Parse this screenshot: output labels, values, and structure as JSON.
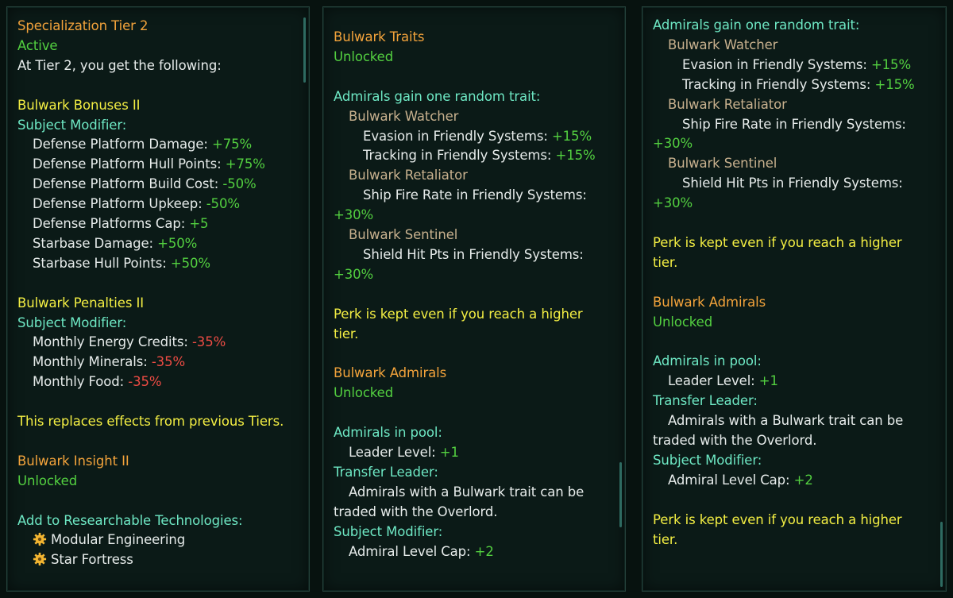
{
  "panel1": {
    "title": "Specialization Tier 2",
    "status": "Active",
    "intro": "At Tier 2, you get the following:",
    "bonuses_title": "Bulwark Bonuses II",
    "bonuses_subject": "Subject Modifier:",
    "bonuses": [
      {
        "label": "Defense Platform Damage: ",
        "value": "+75%"
      },
      {
        "label": "Defense Platform Hull Points: ",
        "value": "+75%"
      },
      {
        "label": "Defense Platform Build Cost: ",
        "value": "-50%"
      },
      {
        "label": "Defense Platform Upkeep: ",
        "value": "-50%"
      },
      {
        "label": "Defense Platforms Cap: ",
        "value": "+5"
      },
      {
        "label": "Starbase Damage: ",
        "value": "+50%"
      },
      {
        "label": "Starbase Hull Points: ",
        "value": "+50%"
      }
    ],
    "penalties_title": "Bulwark Penalties II",
    "penalties_subject": "Subject Modifier:",
    "penalties": [
      {
        "label": "Monthly Energy Credits: ",
        "value": "-35%"
      },
      {
        "label": "Monthly Minerals: ",
        "value": "-35%"
      },
      {
        "label": "Monthly Food: ",
        "value": "-35%"
      }
    ],
    "replace_note": "This replaces effects from previous Tiers.",
    "insight_title": "Bulwark Insight II",
    "insight_status": "Unlocked",
    "research_heading": "Add to Researchable Technologies:",
    "techs": [
      "Modular Engineering",
      "Star Fortress"
    ]
  },
  "panel2": {
    "traits_title": "Bulwark Traits",
    "traits_status": "Unlocked",
    "trait_intro": "Admirals gain one random trait:",
    "watcher_name": "Bulwark Watcher",
    "watcher_effects": [
      {
        "label": "Evasion in Friendly Systems: ",
        "value": "+15%"
      },
      {
        "label": "Tracking in Friendly Systems: ",
        "value": "+15%"
      }
    ],
    "retaliator_name": "Bulwark Retaliator",
    "retaliator_effect_label": "Ship Fire Rate in Friendly Systems:",
    "retaliator_effect_value": "+30%",
    "sentinel_name": "Bulwark Sentinel",
    "sentinel_effect_label": "Shield Hit Pts in Friendly Systems:",
    "sentinel_effect_value": "+30%",
    "perk_note_1": "Perk is kept even if you reach a higher",
    "perk_note_2": "tier.",
    "admirals_title": "Bulwark Admirals",
    "admirals_status": "Unlocked",
    "pool_heading": "Admirals in pool:",
    "leader_level_label": "Leader Level: ",
    "leader_level_value": "+1",
    "transfer_heading": "Transfer Leader:",
    "transfer_text_1": "Admirals with a Bulwark trait can be",
    "transfer_text_2": "traded with the Overlord.",
    "subject_heading": "Subject Modifier:",
    "admiral_cap_label": "Admiral Level Cap: ",
    "admiral_cap_value": "+2"
  },
  "panel3": {
    "trait_intro": "Admirals gain one random trait:",
    "watcher_name": "Bulwark Watcher",
    "watcher_effects": [
      {
        "label": "Evasion in Friendly Systems: ",
        "value": "+15%"
      },
      {
        "label": "Tracking in Friendly Systems: ",
        "value": "+15%"
      }
    ],
    "retaliator_name": "Bulwark Retaliator",
    "retaliator_effect_label": "Ship Fire Rate in Friendly Systems:",
    "retaliator_effect_value": "+30%",
    "sentinel_name": "Bulwark Sentinel",
    "sentinel_effect_label": "Shield Hit Pts in Friendly Systems:",
    "sentinel_effect_value": "+30%",
    "perk_note_1": "Perk is kept even if you reach a higher",
    "perk_note_2": "tier.",
    "admirals_title": "Bulwark Admirals",
    "admirals_status": "Unlocked",
    "pool_heading": "Admirals in pool:",
    "leader_level_label": "Leader Level: ",
    "leader_level_value": "+1",
    "transfer_heading": "Transfer Leader:",
    "transfer_text_1": "Admirals with a Bulwark trait can be",
    "transfer_text_2": "traded with the Overlord.",
    "subject_heading": "Subject Modifier:",
    "admiral_cap_label": "Admiral Level Cap: ",
    "admiral_cap_value": "+2",
    "perk_note_end_1": "Perk is kept even if you reach a higher",
    "perk_note_end_2": "tier."
  },
  "colors": {
    "title_orange": "#f3a33b",
    "status_green": "#53d040",
    "note_yellow": "#f3ee43",
    "subject_cyan": "#6ee8c4",
    "trait_tan": "#c8b18e",
    "negative_red": "#ee4c44",
    "panel_bg": "#0b1a17"
  },
  "icons": {
    "tech": "gear-icon"
  }
}
